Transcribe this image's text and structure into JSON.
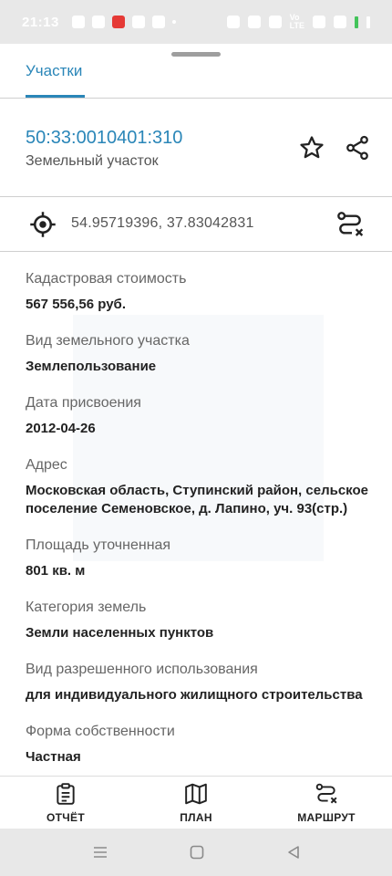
{
  "status_bar": {
    "time": "21:13"
  },
  "tabs": [
    {
      "label": "Участки",
      "active": true
    }
  ],
  "parcel": {
    "cadastral_number": "50:33:0010401:310",
    "object_type": "Земельный участок",
    "coordinates": "54.95719396, 37.83042831"
  },
  "fields": [
    {
      "label": "Кадастровая стоимость",
      "value": "567 556,56 руб."
    },
    {
      "label": "Вид земельного участка",
      "value": "Землепользование"
    },
    {
      "label": "Дата присвоения",
      "value": "2012-04-26"
    },
    {
      "label": "Адрес",
      "value": "Московская область, Ступинский район, сельское поселение Семеновское, д. Лапино, уч. 93(стр.)"
    },
    {
      "label": "Площадь уточненная",
      "value": "801 кв. м"
    },
    {
      "label": "Категория земель",
      "value": "Земли населенных пунктов"
    },
    {
      "label": "Вид разрешенного использования",
      "value": "для индивидуального жилищного строительства"
    },
    {
      "label": "Форма собственности",
      "value": "Частная"
    }
  ],
  "bottom_nav": {
    "report": "ОТЧЁТ",
    "plan": "ПЛАН",
    "route": "МАРШРУТ"
  },
  "colors": {
    "accent": "#2a86b8",
    "divider": "#cfcfcf",
    "system_bar": "#e8e8e8"
  },
  "icons": [
    "star-icon",
    "share-icon",
    "target-icon",
    "route-icon",
    "clipboard-icon",
    "map-icon"
  ]
}
